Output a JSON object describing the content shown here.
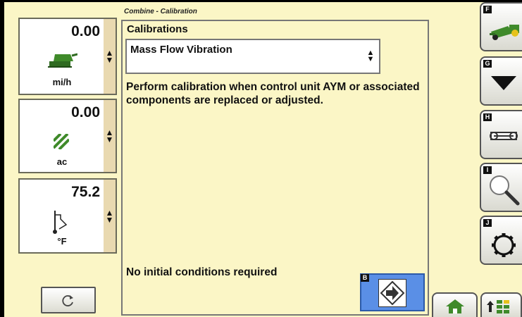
{
  "header": {
    "title": "Combine - Calibration"
  },
  "status_panels": [
    {
      "value": "0.00",
      "unit": "mi/h",
      "icon": "combine-speed-icon"
    },
    {
      "value": "0.00",
      "unit": "ac",
      "icon": "area-hatch-icon"
    },
    {
      "value": "75.2",
      "unit": "°F",
      "icon": "thermometer-icon"
    }
  ],
  "main": {
    "section_label": "Calibrations",
    "dropdown_value": "Mass Flow Vibration",
    "description": "Perform calibration when control unit AYM or associated components are replaced or adjusted.",
    "conditions": "No initial conditions required",
    "next_key": "B"
  },
  "softkeys": [
    {
      "key": "F",
      "icon": "combine-icon"
    },
    {
      "key": "G",
      "icon": "down-arrow-icon"
    },
    {
      "key": "H",
      "icon": "wrench-icon"
    },
    {
      "key": "I",
      "icon": "magnifier-icon"
    },
    {
      "key": "J",
      "icon": "gear-icon"
    }
  ],
  "colors": {
    "background": "#fbf6c6",
    "next_button": "#5a8fe6",
    "combine_green": "#3f8a2a"
  }
}
